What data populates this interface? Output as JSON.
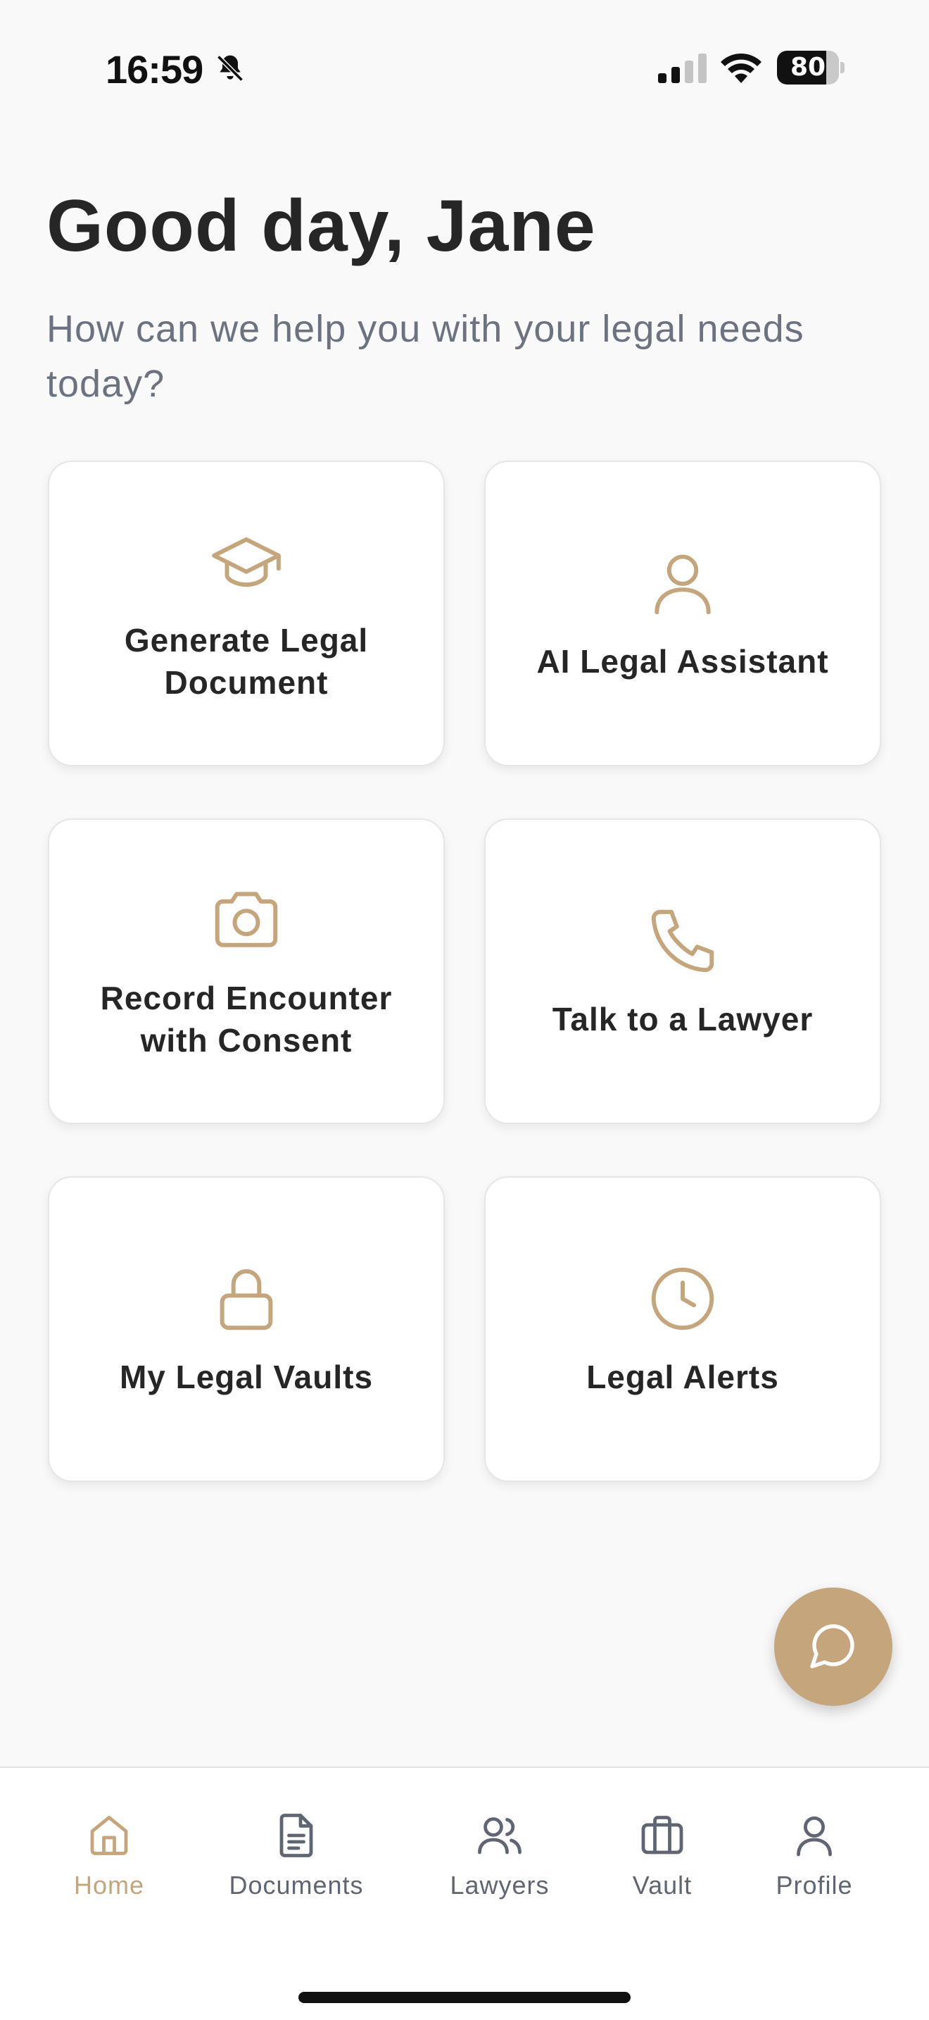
{
  "status_bar": {
    "time": "16:59",
    "battery_level": "80",
    "battery_fraction": 0.8,
    "icons": [
      "bell-slash-icon",
      "cellular-signal-icon",
      "wifi-icon",
      "battery-icon"
    ]
  },
  "header": {
    "greeting": "Good day, Jane",
    "subtitle": "How can we help you with your legal needs today?"
  },
  "cards": [
    {
      "label": "Generate Legal Document",
      "icon": "graduation-cap-icon"
    },
    {
      "label": "AI Legal Assistant",
      "icon": "user-icon"
    },
    {
      "label": "Record Encounter with Consent",
      "icon": "camera-icon"
    },
    {
      "label": "Talk to a Lawyer",
      "icon": "phone-icon"
    },
    {
      "label": "My Legal Vaults",
      "icon": "lock-icon"
    },
    {
      "label": "Legal Alerts",
      "icon": "clock-icon"
    }
  ],
  "fab": {
    "icon": "chat-bubble-icon"
  },
  "tabbar": {
    "items": [
      {
        "label": "Home",
        "icon": "home-icon",
        "active": true
      },
      {
        "label": "Documents",
        "icon": "document-icon",
        "active": false
      },
      {
        "label": "Lawyers",
        "icon": "users-icon",
        "active": false
      },
      {
        "label": "Vault",
        "icon": "briefcase-icon",
        "active": false
      },
      {
        "label": "Profile",
        "icon": "user-icon",
        "active": false
      }
    ]
  },
  "colors": {
    "accent": "#c5a57c",
    "background": "#f9f9f9",
    "text_primary": "#262626",
    "text_secondary": "#6b7280",
    "tab_inactive": "#5f6673"
  }
}
